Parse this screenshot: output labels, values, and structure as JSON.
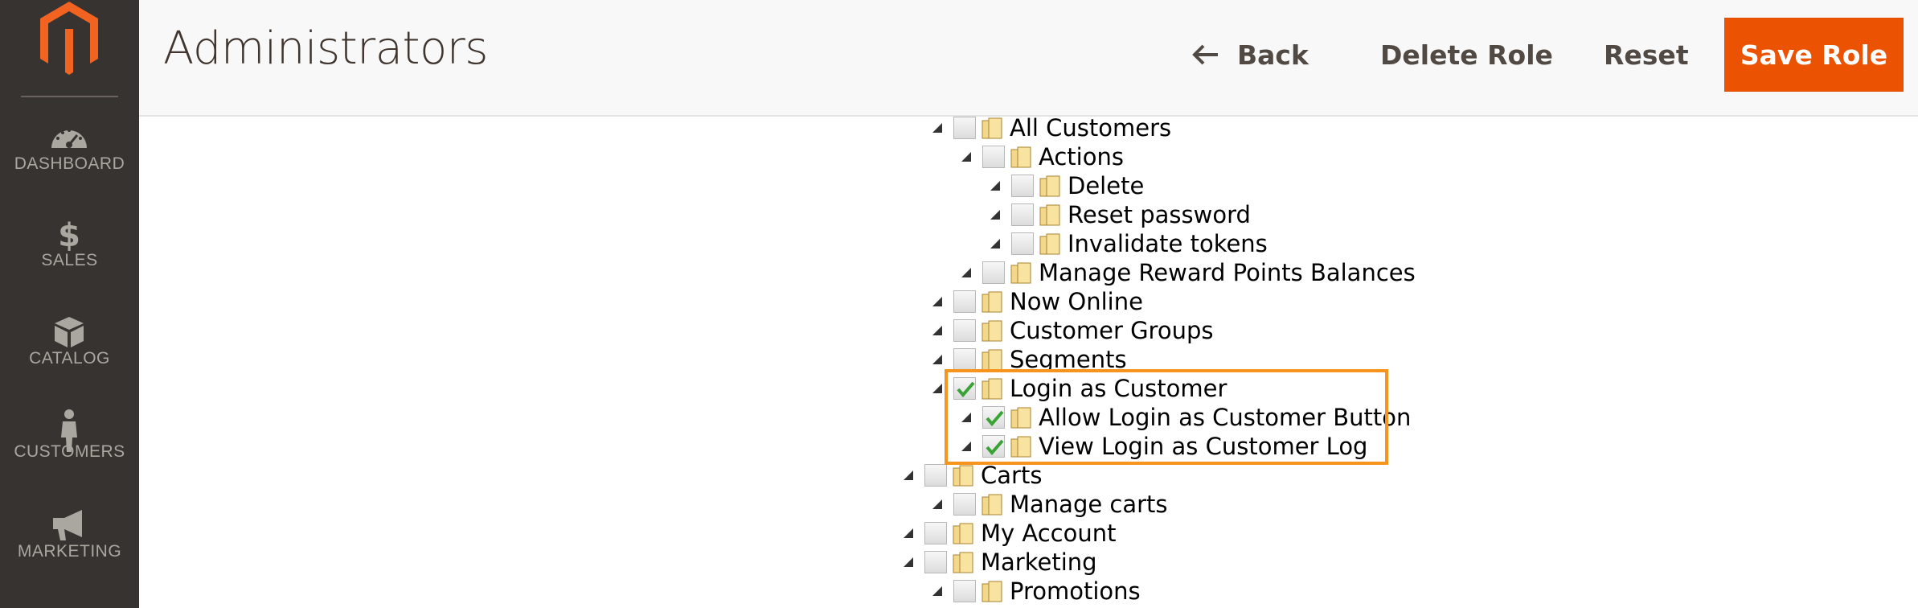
{
  "sidebar": {
    "logo_icon": "magento-logo-icon",
    "items": [
      {
        "label": "DASHBOARD",
        "icon": "dashboard-gauge-icon"
      },
      {
        "label": "SALES",
        "icon": "dollar-icon"
      },
      {
        "label": "CATALOG",
        "icon": "box-icon"
      },
      {
        "label": "CUSTOMERS",
        "icon": "person-icon"
      },
      {
        "label": "MARKETING",
        "icon": "megaphone-icon"
      }
    ]
  },
  "header": {
    "title": "Administrators",
    "back_label": "Back",
    "delete_label": "Delete Role",
    "reset_label": "Reset",
    "save_label": "Save Role"
  },
  "tree": [
    {
      "label": "All Customers",
      "checked": false
    },
    {
      "label": "Actions",
      "checked": false
    },
    {
      "label": "Delete",
      "checked": false
    },
    {
      "label": "Reset password",
      "checked": false
    },
    {
      "label": "Invalidate tokens",
      "checked": false
    },
    {
      "label": "Manage Reward Points Balances",
      "checked": false
    },
    {
      "label": "Now Online",
      "checked": false
    },
    {
      "label": "Customer Groups",
      "checked": false
    },
    {
      "label": "Segments",
      "checked": false
    },
    {
      "label": "Login as Customer",
      "checked": true
    },
    {
      "label": "Allow Login as Customer Button",
      "checked": true
    },
    {
      "label": "View Login as Customer Log",
      "checked": true
    },
    {
      "label": "Carts",
      "checked": false
    },
    {
      "label": "Manage carts",
      "checked": false
    },
    {
      "label": "My Account",
      "checked": false
    },
    {
      "label": "Marketing",
      "checked": false
    },
    {
      "label": "Promotions",
      "checked": false
    }
  ],
  "colors": {
    "sidebar_bg": "#373330",
    "accent": "#eb5202",
    "highlight": "#f7941d",
    "checkmark": "#3aa335"
  }
}
